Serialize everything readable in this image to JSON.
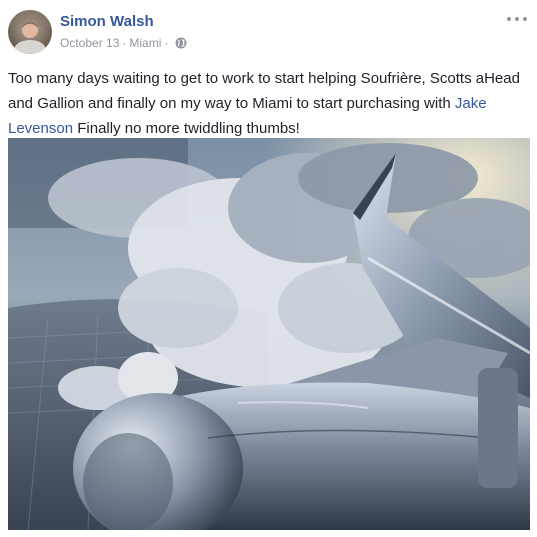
{
  "post": {
    "author": "Simon Walsh",
    "date": "October 13",
    "separator": "·",
    "location": "Miami",
    "privacy_icon": "globe-icon",
    "more_icon": "more-options-icon",
    "text_before": "Too many days waiting to get to work to start helping Soufrière, Scotts aHead and Gallion and finally on my way to Miami to start purchasing with ",
    "mention": "Jake Levenson",
    "text_after": " Finally no more twiddling thumbs!"
  },
  "colors": {
    "link": "#365899",
    "meta": "#90949c",
    "text": "#1d2129"
  }
}
